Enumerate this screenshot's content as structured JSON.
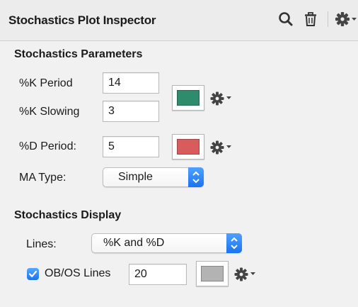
{
  "header": {
    "title": "Stochastics Plot Inspector",
    "icons": [
      "search-icon",
      "trash-icon",
      "gear-dropdown-icon"
    ]
  },
  "params": {
    "section_title": "Stochastics Parameters",
    "k_period": {
      "label": "%K Period",
      "value": "14"
    },
    "k_slowing": {
      "label": "%K Slowing",
      "value": "3"
    },
    "k_color": "#2e8b6b",
    "d_period": {
      "label": "%D Period:",
      "value": "5"
    },
    "d_color": "#d95c5c",
    "ma_type": {
      "label": "MA Type:",
      "value": "Simple"
    }
  },
  "display": {
    "section_title": "Stochastics Display",
    "lines": {
      "label": "Lines:",
      "value": "%K and %D"
    },
    "obos": {
      "label": "OB/OS Lines",
      "checked": true,
      "value": "20",
      "color": "#b3b3b3"
    }
  }
}
